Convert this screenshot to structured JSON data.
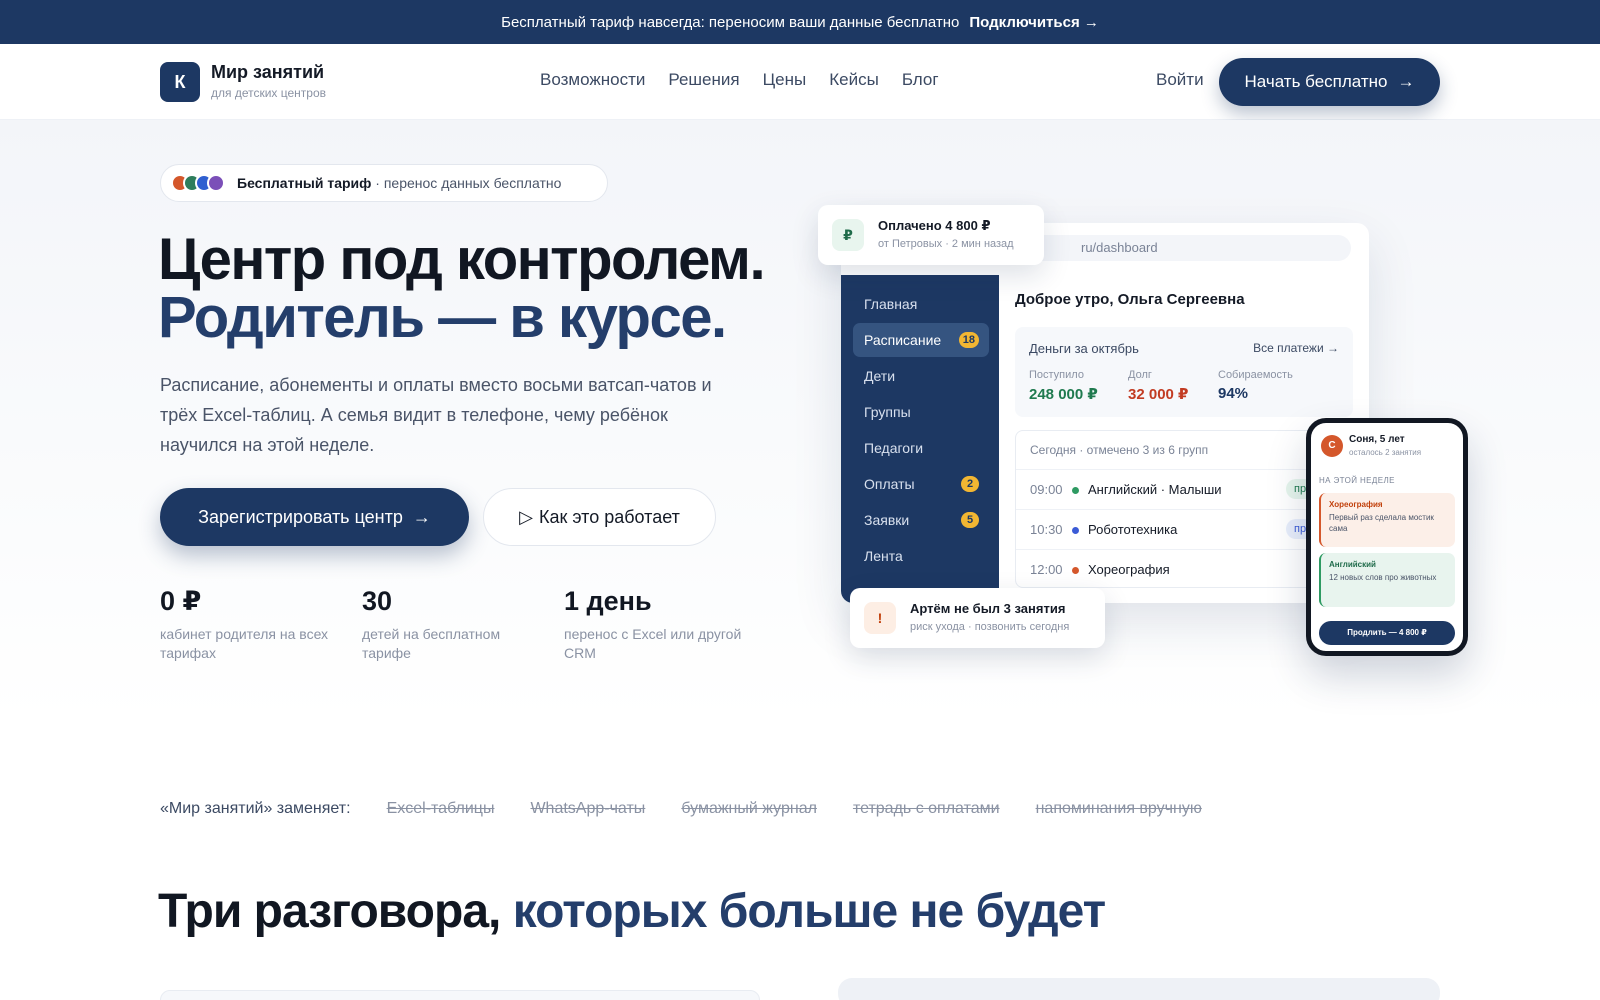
{
  "announcement": {
    "text": "Бесплатный тариф навсегда: переносим ваши данные бесплатно",
    "cta": "Подключиться →"
  },
  "nav": {
    "logo_letter": "К",
    "brand": "Мир занятий",
    "brand_sub": "для детских центров",
    "items": [
      "Возможности",
      "Решения",
      "Цены",
      "Кейсы",
      "Блог"
    ],
    "login": "Войти",
    "start": "Начать бесплатно",
    "arrow": "→"
  },
  "hero": {
    "pill_dot_colors": [
      "#d4572b",
      "#2e7d5b",
      "#2f5fd0",
      "#7b4fb8"
    ],
    "pill_bold": "Бесплатный тариф",
    "pill_rest": "· перенос данных бесплатно",
    "title_line1": "Центр под контролем.",
    "title_line2": "Родитель — в курсе.",
    "lead": "Расписание, абонементы и оплаты вместо восьми ватсап-чатов и трёх Excel-таблиц. А семья видит в телефоне, чему ребёнок научился на этой неделе.",
    "primary_button": "Зарегистрировать центр",
    "primary_arrow": "→",
    "secondary_icon": "▷",
    "secondary_button": "Как это работает",
    "stats": [
      {
        "value": "0 ₽",
        "label": "кабинет родителя на всех тарифах"
      },
      {
        "value": "30",
        "label": "детей на бесплатном тарифе"
      },
      {
        "value": "1 день",
        "label": "перенос с Excel или другой CRM"
      }
    ]
  },
  "dashboard": {
    "url": "ru/dashboard",
    "sidebar": [
      {
        "label": "Главная",
        "badge": ""
      },
      {
        "label": "Расписание",
        "badge": "18"
      },
      {
        "label": "Дети",
        "badge": ""
      },
      {
        "label": "Группы",
        "badge": ""
      },
      {
        "label": "Педагоги",
        "badge": ""
      },
      {
        "label": "Оплаты",
        "badge": "2"
      },
      {
        "label": "Заявки",
        "badge": "5"
      },
      {
        "label": "Лента",
        "badge": ""
      }
    ],
    "greeting": "Доброе утро, Ольга Сергеевна",
    "money": {
      "title": "Деньги за октябрь",
      "all_link": "Все платежи →",
      "cols": [
        {
          "label": "Поступило",
          "value": "248 000 ₽",
          "color": "#1f7a4f"
        },
        {
          "label": "Долг",
          "value": "32 000 ₽",
          "color": "#c23b22"
        },
        {
          "label": "Собираемость",
          "value": "94%",
          "color": "#1d3863"
        }
      ]
    },
    "today": {
      "header": "Сегодня · отмечено 3 из 6 групп",
      "rows": [
        {
          "time": "09:00",
          "name": "Английский · Малыши",
          "dot": "#2e9a62",
          "tag": "при",
          "tag_bg": "#e6f5ec",
          "tag_fg": "#1f7a4f"
        },
        {
          "time": "10:30",
          "name": "Робототехника",
          "dot": "#3b5bd6",
          "tag": "при",
          "tag_bg": "#e8eefb",
          "tag_fg": "#3b5bd6"
        },
        {
          "time": "12:00",
          "name": "Хореография",
          "dot": "#d4572b",
          "tag": "",
          "tag_bg": "#ffffff",
          "tag_fg": "#ffffff"
        }
      ]
    }
  },
  "paid_card": {
    "icon": "₽",
    "title": "Оплачено 4 800 ₽",
    "sub": "от Петровых · 2 мин назад"
  },
  "alert_card": {
    "icon": "!",
    "title": "Артём не был 3 занятия",
    "sub": "риск ухода · позвонить сегодня"
  },
  "phone": {
    "avatar": "С",
    "name": "Соня, 5 лет",
    "sub": "осталось 2 занятия",
    "week": "НА ЭТОЙ НЕДЕЛЕ",
    "cards": [
      {
        "title": "Хореография",
        "text": "Первый раз сделала мостик сама",
        "bg": "#fcefe8",
        "fg": "#c2410c",
        "border": "#d4572b"
      },
      {
        "title": "Английский",
        "text": "12 новых слов про животных",
        "bg": "#e8f4ee",
        "fg": "#1f6b4a",
        "border": "#2e9a62"
      }
    ],
    "button": "Продлить — 4 800 ₽"
  },
  "replaces": {
    "label": "«Мир занятий» заменяет:",
    "items": [
      "Excel-таблицы",
      "WhatsApp-чаты",
      "бумажный журнал",
      "тетрадь с оплатами",
      "напоминания вручную"
    ]
  },
  "section": {
    "title_part1": "Три разговора,",
    "title_part2": "которых больше не будет"
  }
}
